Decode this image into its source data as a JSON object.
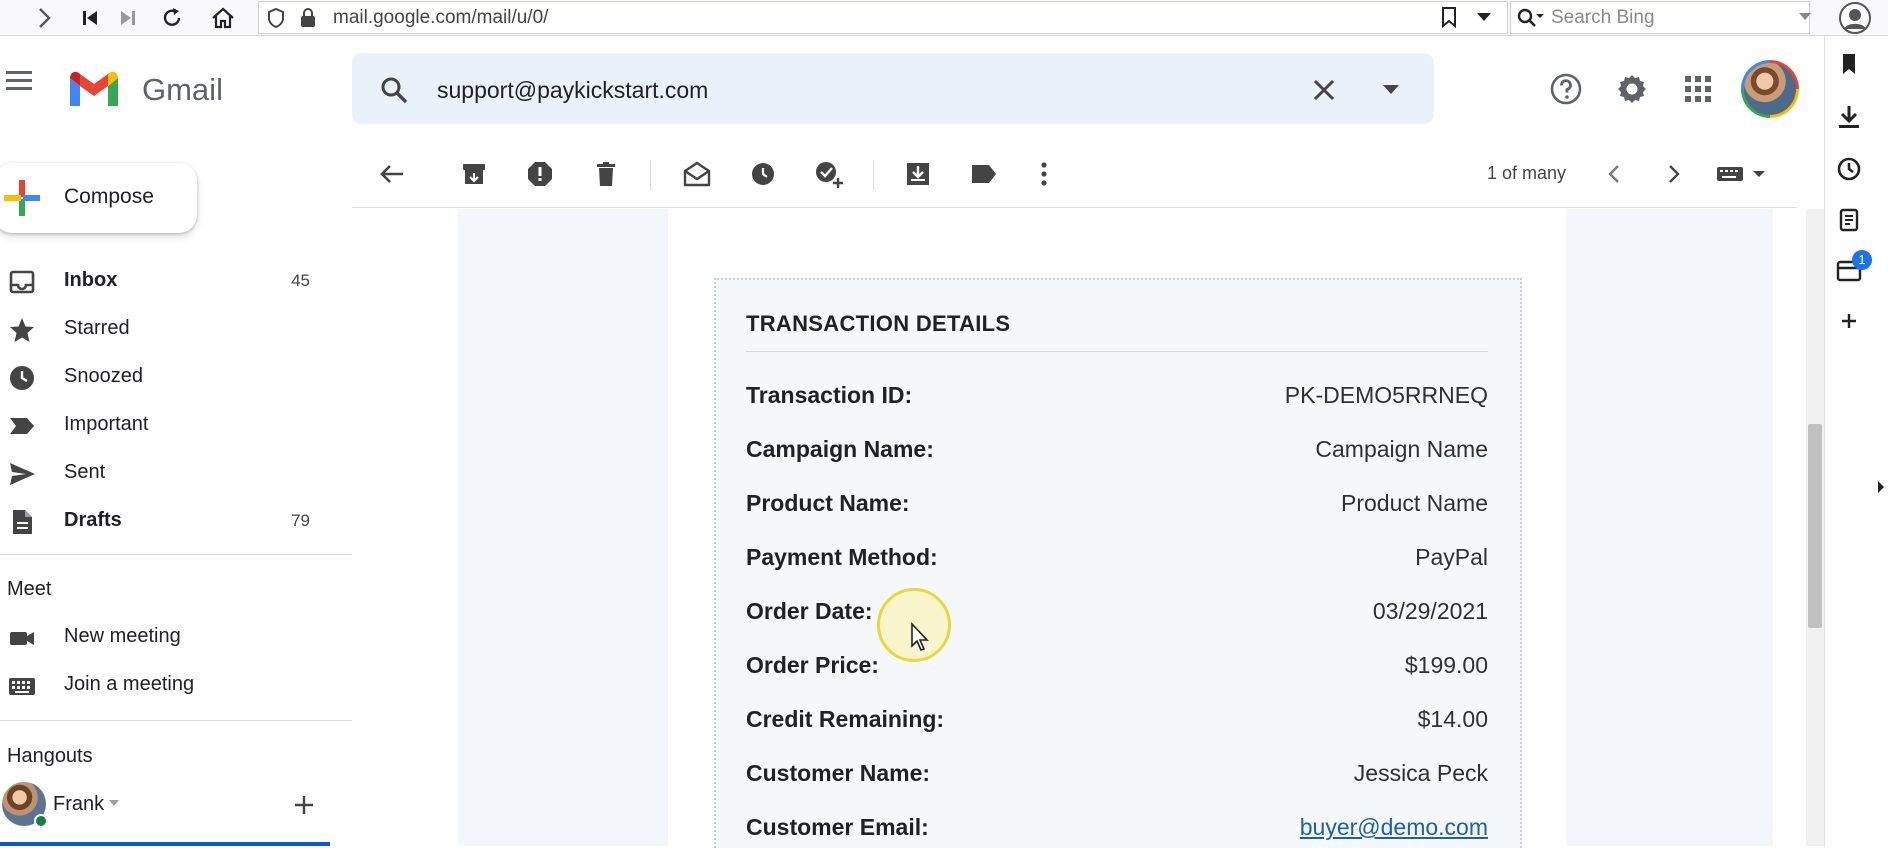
{
  "browser": {
    "url": "mail.google.com/mail/u/0/",
    "search_placeholder": "Search Bing"
  },
  "gmail": {
    "product_name": "Gmail",
    "search_query": "support@paykickstart.com"
  },
  "nav": {
    "compose_label": "Compose",
    "items": [
      {
        "label": "Inbox",
        "count": "45",
        "icon": "inbox-icon",
        "bold": true
      },
      {
        "label": "Starred",
        "count": "",
        "icon": "star-icon",
        "bold": false
      },
      {
        "label": "Snoozed",
        "count": "",
        "icon": "clock-icon",
        "bold": false
      },
      {
        "label": "Important",
        "count": "",
        "icon": "important-icon",
        "bold": false
      },
      {
        "label": "Sent",
        "count": "",
        "icon": "send-icon",
        "bold": false
      },
      {
        "label": "Drafts",
        "count": "79",
        "icon": "draft-icon",
        "bold": true
      }
    ],
    "meet": {
      "title": "Meet",
      "new_meeting": "New meeting",
      "join_meeting": "Join a meeting"
    },
    "hangouts": {
      "title": "Hangouts",
      "user": "Frank"
    }
  },
  "toolbar": {
    "pager": "1 of many"
  },
  "email": {
    "section_title": "TRANSACTION DETAILS",
    "rows": [
      {
        "label": "Transaction ID:",
        "value": "PK-DEMO5RRNEQ"
      },
      {
        "label": "Campaign Name:",
        "value": "Campaign Name"
      },
      {
        "label": "Product Name:",
        "value": "Product Name"
      },
      {
        "label": "Payment Method:",
        "value": "PayPal"
      },
      {
        "label": "Order Date:",
        "value": "03/29/2021"
      },
      {
        "label": "Order Price:",
        "value": "$199.00"
      },
      {
        "label": "Credit Remaining:",
        "value": "$14.00"
      },
      {
        "label": "Customer Name:",
        "value": "Jessica Peck"
      },
      {
        "label": "Customer Email:",
        "value": "buyer@demo.com"
      }
    ]
  },
  "side_panel": {
    "calendar_badge": "1"
  },
  "colors": {
    "search_bg": "#eaf1fb",
    "link": "#1a5fb4",
    "card_bg": "#f5f8fb"
  }
}
